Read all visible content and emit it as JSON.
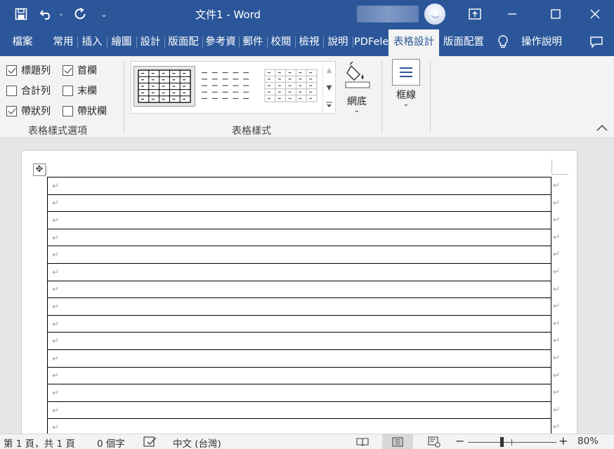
{
  "titlebar": {
    "title": "文件1  -  Word",
    "icons": [
      "save-icon",
      "undo-icon",
      "redo-icon",
      "customize-qat-icon",
      "ribbon-display-options-icon",
      "minimize-icon",
      "maximize-icon",
      "close-icon"
    ]
  },
  "tabs": [
    {
      "label": "檔案"
    },
    {
      "label": "常用"
    },
    {
      "label": "插入"
    },
    {
      "label": "繪圖"
    },
    {
      "label": "設計"
    },
    {
      "label": "版面配"
    },
    {
      "label": "參考資"
    },
    {
      "label": "郵件"
    },
    {
      "label": "校閱"
    },
    {
      "label": "檢視"
    },
    {
      "label": "說明"
    },
    {
      "label": "PDFele"
    },
    {
      "label": "表格設計",
      "active": true
    },
    {
      "label": "版面配置"
    }
  ],
  "tell_me": {
    "label": "操作說明"
  },
  "ribbon": {
    "style_options": {
      "label": "表格樣式選項",
      "header_row": {
        "label": "標題列",
        "checked": true
      },
      "first_column": {
        "label": "首欄",
        "checked": true
      },
      "total_row": {
        "label": "合計列",
        "checked": false
      },
      "last_column": {
        "label": "末欄",
        "checked": false
      },
      "banded_rows": {
        "label": "帶狀列",
        "checked": true
      },
      "banded_columns": {
        "label": "帶狀欄",
        "checked": false
      }
    },
    "table_styles": {
      "label": "表格樣式",
      "shading_label": "網底"
    },
    "borders": {
      "label": "框線"
    }
  },
  "document": {
    "rows": 15,
    "paragraph_mark": "↵"
  },
  "statusbar": {
    "page": "第 1 頁，共 1 頁",
    "words": "0 個字",
    "language": "中文 (台灣)",
    "zoom": "80%",
    "zoom_level": 0.8
  },
  "colors": {
    "accent": "#2b579a",
    "ribbon_bg": "#f3f3f3",
    "doc_bg": "#e6e6e6"
  }
}
